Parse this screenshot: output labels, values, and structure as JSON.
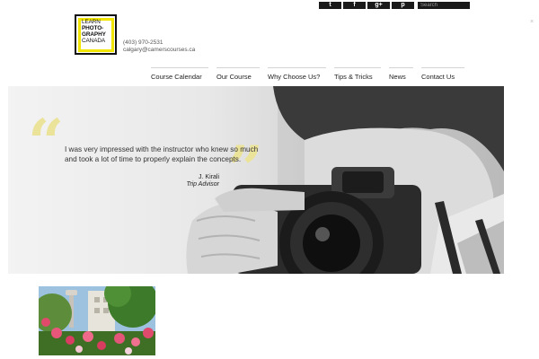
{
  "header": {
    "social": [
      {
        "name": "twitter-icon",
        "glyph": "t"
      },
      {
        "name": "facebook-icon",
        "glyph": "f"
      },
      {
        "name": "google-plus-icon",
        "glyph": "g+"
      },
      {
        "name": "pinterest-icon",
        "glyph": "p"
      }
    ],
    "search_placeholder": "Search",
    "close_glyph": "×"
  },
  "logo": {
    "line1": "LEARN",
    "line2": "PHOTO-",
    "line3": "GRAPHY",
    "line4": "CANADA"
  },
  "contact": {
    "phone": "(403) 970-2531",
    "email": "calgary@camerscourses.ca"
  },
  "nav": {
    "items": [
      {
        "label": "Course Calendar"
      },
      {
        "label": "Our Course"
      },
      {
        "label": "Why Choose Us?"
      },
      {
        "label": "Tips & Tricks"
      },
      {
        "label": "News"
      },
      {
        "label": "Contact Us"
      }
    ]
  },
  "hero": {
    "quote": "I was very impressed with the instructor who knew so much and took a lot of time to properly explain the concepts.",
    "author": "J. Kirali",
    "source": "Trip Advisor",
    "open_quote": "“",
    "close_quote": "”"
  },
  "colors": {
    "accent_yellow": "#f2e500",
    "quote_yellow": "#ece39a",
    "bar_dark": "#1a1a1a"
  }
}
